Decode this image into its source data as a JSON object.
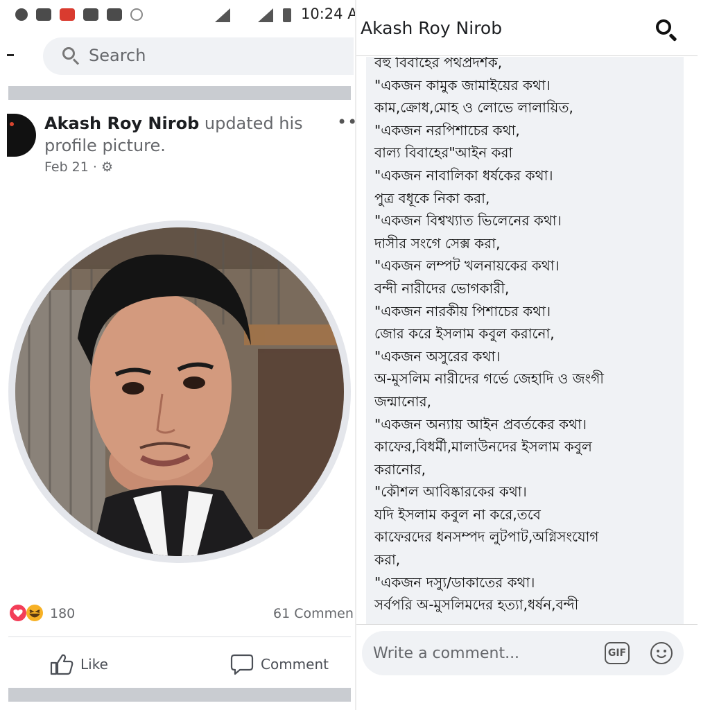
{
  "status_bar": {
    "time": "10:24 A",
    "icons": [
      "messenger-icon",
      "app-icon",
      "vivaldi-icon",
      "youtube-icon",
      "chat-icon",
      "sync-icon",
      "signal-icon",
      "signal-icon",
      "battery-icon"
    ]
  },
  "left": {
    "search": {
      "placeholder": "Search"
    },
    "post": {
      "author": "Akash Roy Nirob",
      "action": " updated his profile picture.",
      "date": "Feb 21 · ",
      "privacy_icon": "gear-icon",
      "menu_icon": "more-icon"
    },
    "reactions": {
      "count": "180",
      "types": [
        "love",
        "haha"
      ]
    },
    "comments_count": "61 Commen",
    "actions": {
      "like": "Like",
      "comment": "Comment"
    }
  },
  "right": {
    "title": "Akash Roy Nirob",
    "poem_lines": [
      "বহু বিবাহের পথপ্রদর্শক,",
      "\"একজন কামুক জামাইয়ের কথা।",
      "কাম,ক্রোধ,মোহ ও লোভে লালায়িত,",
      "\"একজন নরপিশাচের কথা,",
      "বাল্য বিবাহের\"আইন করা",
      "\"একজন নাবালিকা ধর্ষকের কথা।",
      "পুত্র বধূকে নিকা করা,",
      "\"একজন বিশ্বখ্যাত ভিলেনের কথা।",
      "দাসীর সংগে সেক্স করা,",
      "\"একজন লম্পট খলনায়কের কথা।",
      "বন্দী নারীদের ভোগকারী,",
      "\"একজন নারকীয় পিশাচের কথা।",
      "জোর করে ইসলাম কবুল করানো,",
      "\"একজন অসুরের কথা।",
      "অ-মুসলিম নারীদের গর্ভে জেহাদি ও জংগী",
      "জন্মানোর,",
      "\"একজন অন্যায় আইন প্রবর্তকের কথা।",
      "কাফের,বিধর্মী,মালাউনদের ইসলাম কবুল",
      "করানোর,",
      "\"কৌশল আবিষ্কারকের কথা।",
      "যদি ইসলাম কবুল না করে,তবে",
      "কাফেরদের ধনসম্পদ লুটপাট,অগ্নিসংযোগ",
      "করা,",
      "\"একজন দস্যু/ডাকাতের কথা।",
      "সর্বপরি অ-মুসলিমদের হত্যা,ধর্ষন,বন্দী"
    ],
    "comment_input": {
      "placeholder": "Write a comment..."
    },
    "gif_label": "GIF"
  }
}
